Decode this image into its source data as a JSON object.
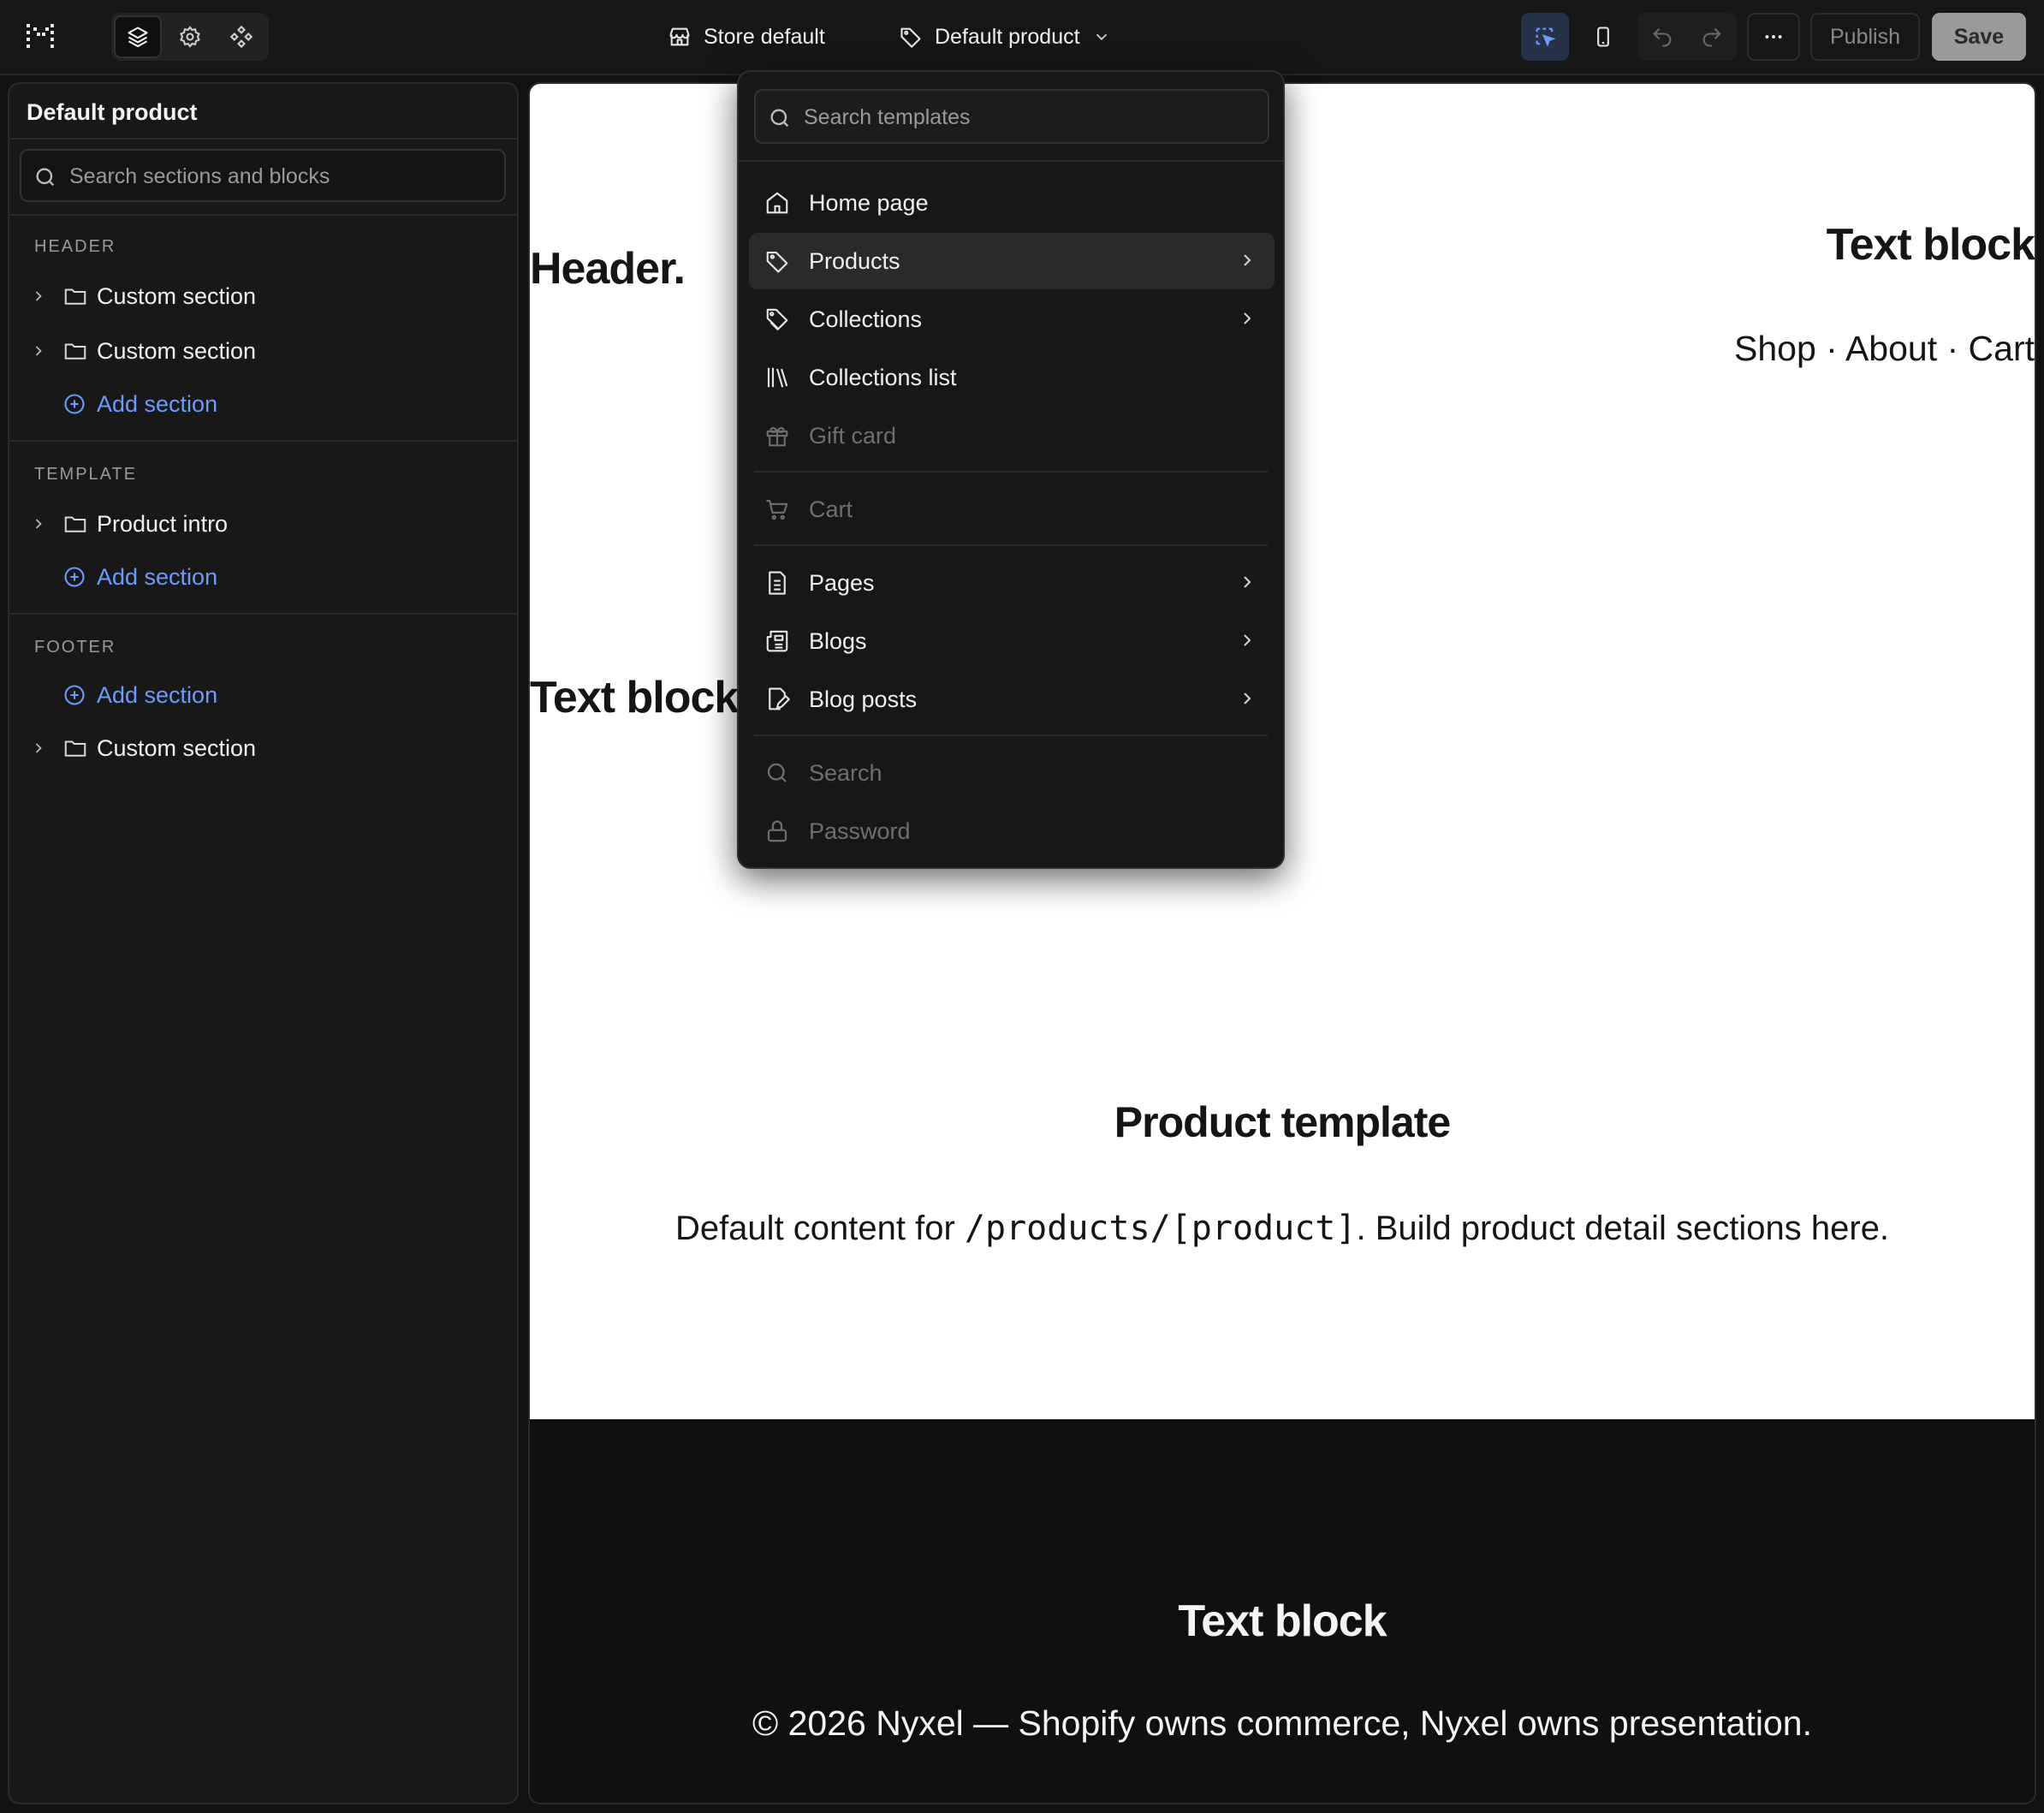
{
  "topbar": {
    "store_label": "Store default",
    "template_label": "Default product",
    "publish_label": "Publish",
    "save_label": "Save",
    "more_label": "···"
  },
  "sidebar": {
    "title": "Default product",
    "search_placeholder": "Search sections and blocks",
    "groups": {
      "header": {
        "label": "HEADER",
        "items": [
          "Custom section",
          "Custom section"
        ],
        "add_label": "Add section"
      },
      "template": {
        "label": "TEMPLATE",
        "items": [
          "Product intro"
        ],
        "add_label": "Add section"
      },
      "footer": {
        "label": "FOOTER",
        "add_label": "Add section",
        "items": [
          "Custom section"
        ]
      }
    }
  },
  "preview": {
    "header_text": "Header.",
    "top_right_text_block": "Text block",
    "nav_text": "Shop · About · Cart",
    "left_text_block": "Text block",
    "product_title": "Product template",
    "desc_before": "Default content for ",
    "desc_code": "/products/[product]",
    "desc_after": ". Build product detail sections here.",
    "footer_text_block": "Text block",
    "footer_copy": "© 2026 Nyxel — Shopify owns commerce, Nyxel owns presentation."
  },
  "template_menu": {
    "search_placeholder": "Search templates",
    "items": [
      {
        "label": "Home page",
        "icon": "home-icon",
        "has_submenu": false,
        "disabled": false
      },
      {
        "label": "Products",
        "icon": "tag-icon",
        "has_submenu": true,
        "disabled": false,
        "highlighted": true
      },
      {
        "label": "Collections",
        "icon": "tags-icon",
        "has_submenu": true,
        "disabled": false
      },
      {
        "label": "Collections list",
        "icon": "library-icon",
        "has_submenu": false,
        "disabled": false
      },
      {
        "label": "Gift card",
        "icon": "gift-icon",
        "has_submenu": false,
        "disabled": true
      },
      {
        "label": "Cart",
        "icon": "cart-icon",
        "has_submenu": false,
        "disabled": true
      },
      {
        "label": "Pages",
        "icon": "page-icon",
        "has_submenu": true,
        "disabled": false
      },
      {
        "label": "Blogs",
        "icon": "newspaper-icon",
        "has_submenu": true,
        "disabled": false
      },
      {
        "label": "Blog posts",
        "icon": "edit-doc-icon",
        "has_submenu": true,
        "disabled": false
      },
      {
        "label": "Search",
        "icon": "search-icon",
        "has_submenu": false,
        "disabled": true
      },
      {
        "label": "Password",
        "icon": "lock-icon",
        "has_submenu": false,
        "disabled": true
      }
    ]
  },
  "colors": {
    "accent_link": "#6b9bff",
    "save_button_bg": "#9a9a9a",
    "app_bg": "#111111"
  }
}
